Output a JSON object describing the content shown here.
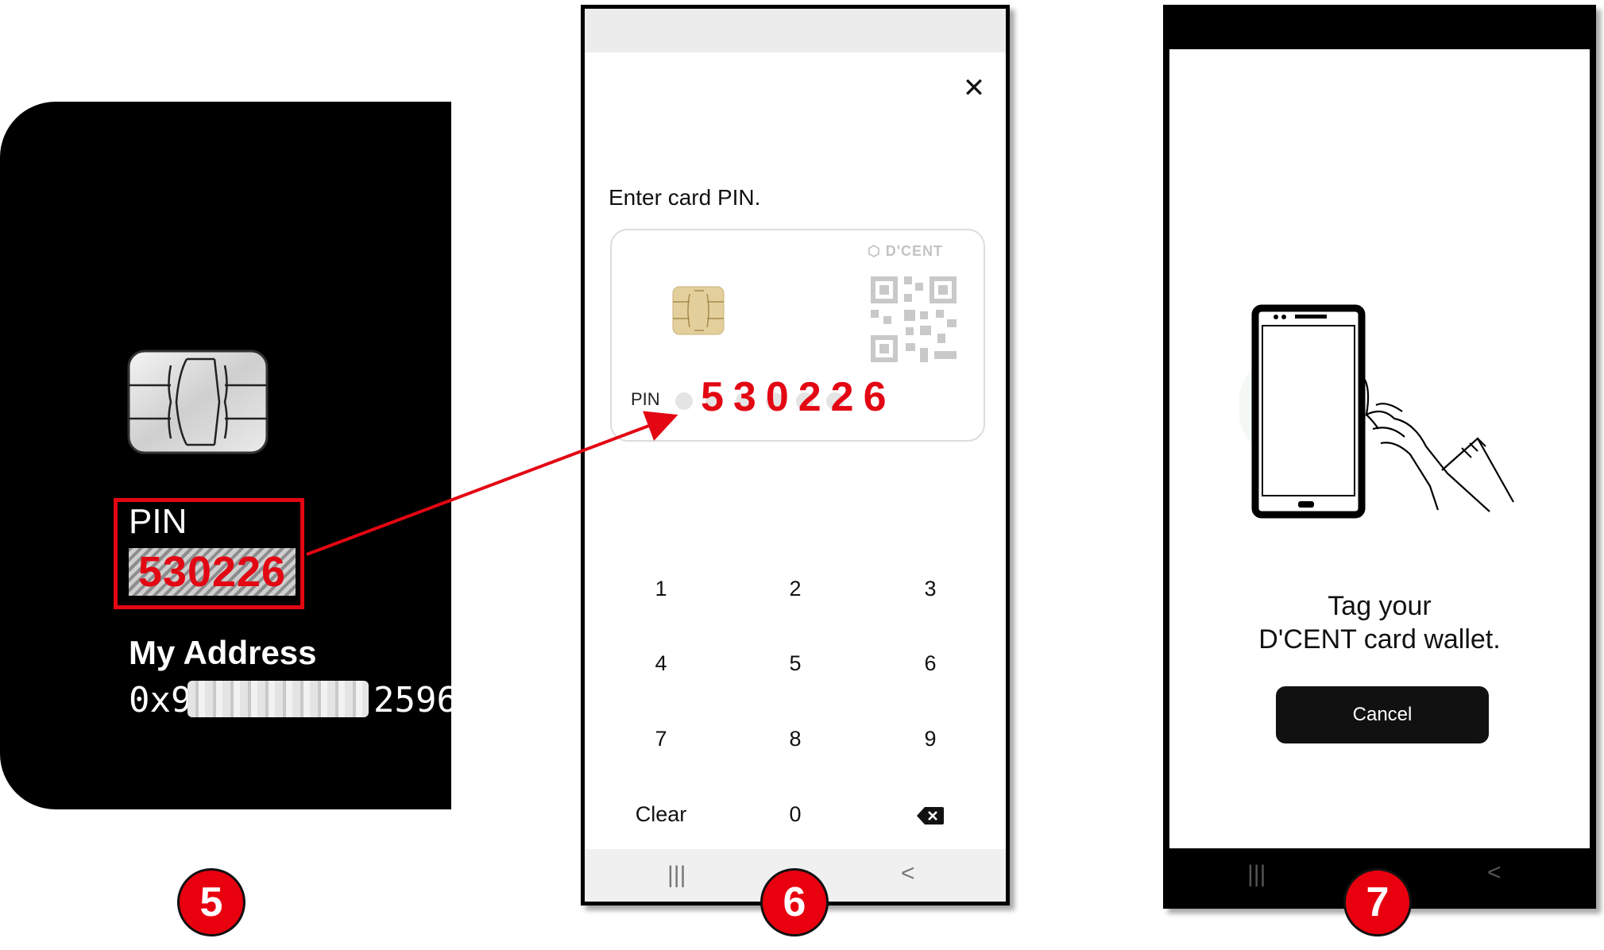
{
  "steps": {
    "five": "5",
    "six": "6",
    "seven": "7"
  },
  "card": {
    "pin_label": "PIN",
    "pin_value": "530226",
    "address_label": "My Address",
    "address_prefix": "0x9",
    "address_suffix": "2596"
  },
  "pin_screen": {
    "close_icon": "close-icon",
    "title": "Enter card PIN.",
    "brand": "D'CENT",
    "pin_label": "PIN",
    "pin_value": "530226",
    "keypad": {
      "k1": "1",
      "k2": "2",
      "k3": "3",
      "k4": "4",
      "k5": "5",
      "k6": "6",
      "k7": "7",
      "k8": "8",
      "k9": "9",
      "clear": "Clear",
      "k0": "0",
      "backspace": "backspace-icon"
    }
  },
  "tag_screen": {
    "title_line1": "Tag your",
    "title_line2": "D'CENT card wallet.",
    "cancel_label": "Cancel"
  },
  "colors": {
    "accent_red": "#e30613",
    "card_black": "#000000"
  }
}
